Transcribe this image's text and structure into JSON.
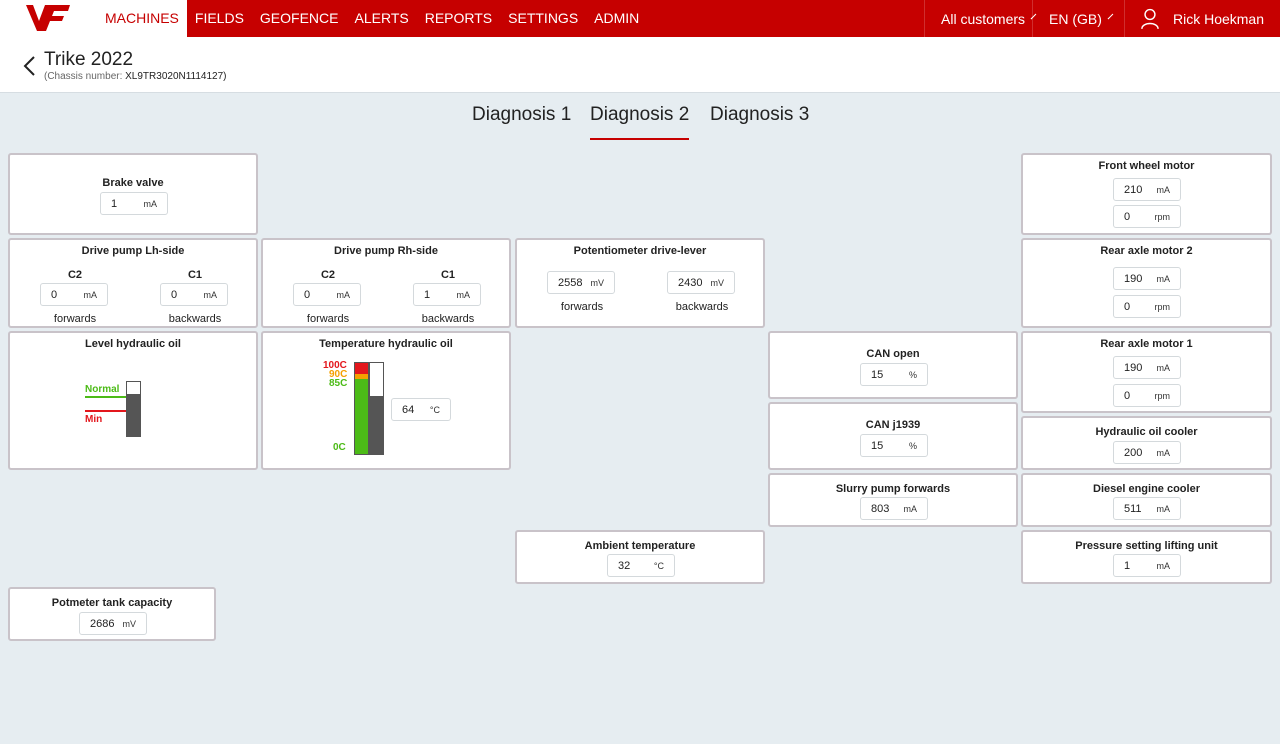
{
  "nav": {
    "brand": "VF",
    "items": [
      "MACHINES",
      "FIELDS",
      "GEOFENCE",
      "ALERTS",
      "REPORTS",
      "SETTINGS",
      "ADMIN"
    ],
    "customers": "All customers",
    "language": "EN (GB)",
    "user": "Rick Hoekman"
  },
  "header": {
    "title": "Trike 2022",
    "chassis_label": "(Chassis number:",
    "chassis_value": "XL9TR3020N1114127)"
  },
  "tabs": [
    "Diagnosis 1",
    "Diagnosis 2",
    "Diagnosis 3"
  ],
  "panels": {
    "brake_valve": {
      "title": "Brake valve",
      "value": "1",
      "unit": "mA"
    },
    "front_wheel_motor": {
      "title": "Front wheel motor",
      "current": "210",
      "current_unit": "mA",
      "speed": "0",
      "speed_unit": "rpm"
    },
    "drive_pump_lh": {
      "title": "Drive pump Lh-side",
      "c2": "C2",
      "c1": "C1",
      "c2_value": "0",
      "c1_value": "0",
      "unit": "mA",
      "forwards": "forwards",
      "backwards": "backwards"
    },
    "drive_pump_rh": {
      "title": "Drive pump Rh-side",
      "c2": "C2",
      "c1": "C1",
      "c2_value": "0",
      "c1_value": "1",
      "unit": "mA",
      "forwards": "forwards",
      "backwards": "backwards"
    },
    "potentiometer": {
      "title": "Potentiometer drive-lever",
      "fwd_value": "2558",
      "bwd_value": "2430",
      "unit": "mV",
      "forwards": "forwards",
      "backwards": "backwards"
    },
    "rear_axle_motor_2": {
      "title": "Rear axle motor 2",
      "current": "190",
      "current_unit": "mA",
      "speed": "0",
      "speed_unit": "rpm"
    },
    "level_hydraulic_oil": {
      "title": "Level hydraulic oil",
      "normal": "Normal",
      "min": "Min",
      "level": 0.78
    },
    "temperature_hydraulic_oil": {
      "title": "Temperature hydraulic oil",
      "t100": "100C",
      "t90": "90C",
      "t85": "85C",
      "t0": "0C",
      "value": "64",
      "unit": "°C",
      "fill": 0.64
    },
    "can_open": {
      "title": "CAN open",
      "value": "15",
      "unit": "%"
    },
    "rear_axle_motor_1": {
      "title": "Rear axle motor 1",
      "current": "190",
      "current_unit": "mA",
      "speed": "0",
      "speed_unit": "rpm"
    },
    "can_j1939": {
      "title": "CAN j1939",
      "value": "15",
      "unit": "%"
    },
    "hydraulic_oil_cooler": {
      "title": "Hydraulic oil cooler",
      "value": "200",
      "unit": "mA"
    },
    "slurry_pump": {
      "title": "Slurry pump forwards",
      "value": "803",
      "unit": "mA"
    },
    "diesel_engine_cooler": {
      "title": "Diesel engine cooler",
      "value": "511",
      "unit": "mA"
    },
    "ambient_temperature": {
      "title": "Ambient temperature",
      "value": "32",
      "unit": "°C"
    },
    "pressure_lifting": {
      "title": "Pressure setting lifting unit",
      "value": "1",
      "unit": "mA"
    },
    "potmeter_tank": {
      "title": "Potmeter tank capacity",
      "value": "2686",
      "unit": "mV"
    }
  },
  "colors": {
    "brand_red": "#c60000",
    "green": "#4cbb17",
    "orange": "#f5a000",
    "red": "#e3161c",
    "gauge_dark": "#555555"
  }
}
